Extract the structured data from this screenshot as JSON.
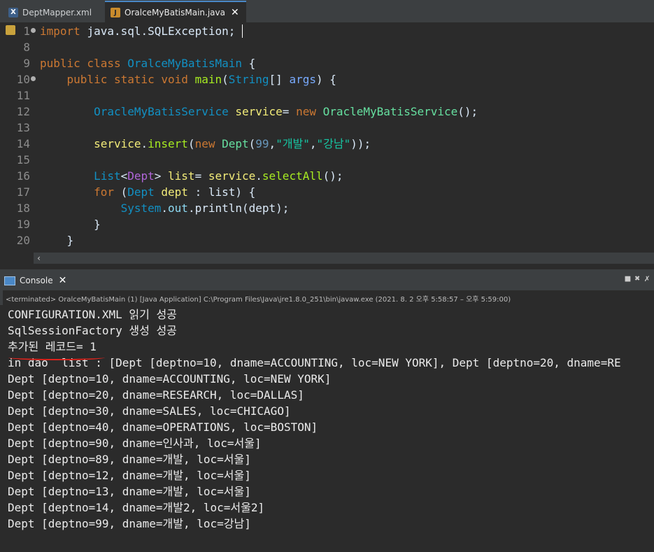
{
  "tabs": [
    {
      "label": "DeptMapper.xml",
      "icon": "xml-file-icon",
      "active": false
    },
    {
      "label": "OralceMyBatisMain.java",
      "icon": "java-file-icon",
      "active": true
    }
  ],
  "editor": {
    "lines": [
      {
        "num": "1",
        "tokens": [
          [
            "kw",
            "import "
          ],
          [
            "plain",
            "java.sql.SQLException;"
          ]
        ]
      },
      {
        "num": "8",
        "tokens": []
      },
      {
        "num": "9",
        "tokens": [
          [
            "kw",
            "public class "
          ],
          [
            "cls",
            "OralceMyBatisMain"
          ],
          [
            "plain",
            " {"
          ]
        ]
      },
      {
        "num": "10",
        "tokens": [
          [
            "kw",
            "    public static void "
          ],
          [
            "method",
            "main"
          ],
          [
            "plain",
            "("
          ],
          [
            "cls",
            "String"
          ],
          [
            "plain",
            "[] "
          ],
          [
            "param",
            "args"
          ],
          [
            "plain",
            ") {"
          ]
        ]
      },
      {
        "num": "11",
        "tokens": []
      },
      {
        "num": "12",
        "tokens": [
          [
            "plain",
            "        "
          ],
          [
            "cls",
            "OracleMyBatisService"
          ],
          [
            "plain",
            " "
          ],
          [
            "var",
            "service"
          ],
          [
            "plain",
            "= "
          ],
          [
            "kw",
            "new "
          ],
          [
            "cls2",
            "OracleMyBatisService"
          ],
          [
            "plain",
            "();"
          ]
        ]
      },
      {
        "num": "13",
        "tokens": []
      },
      {
        "num": "14",
        "tokens": [
          [
            "plain",
            "        "
          ],
          [
            "var",
            "service"
          ],
          [
            "plain",
            "."
          ],
          [
            "method",
            "insert"
          ],
          [
            "plain",
            "("
          ],
          [
            "kw",
            "new "
          ],
          [
            "cls2",
            "Dept"
          ],
          [
            "plain",
            "("
          ],
          [
            "num",
            "99"
          ],
          [
            "plain",
            ","
          ],
          [
            "str",
            "\"개발\""
          ],
          [
            "plain",
            ","
          ],
          [
            "str",
            "\"강남\""
          ],
          [
            "plain",
            "));"
          ]
        ]
      },
      {
        "num": "15",
        "tokens": []
      },
      {
        "num": "16",
        "tokens": [
          [
            "plain",
            "        "
          ],
          [
            "cls",
            "List"
          ],
          [
            "plain",
            "<"
          ],
          [
            "type",
            "Dept"
          ],
          [
            "plain",
            "> "
          ],
          [
            "var",
            "list"
          ],
          [
            "plain",
            "= "
          ],
          [
            "var",
            "service"
          ],
          [
            "plain",
            "."
          ],
          [
            "method",
            "selectAll"
          ],
          [
            "plain",
            "();"
          ]
        ]
      },
      {
        "num": "17",
        "tokens": [
          [
            "kw",
            "        for "
          ],
          [
            "plain",
            "("
          ],
          [
            "cls",
            "Dept"
          ],
          [
            "plain",
            " "
          ],
          [
            "var",
            "dept"
          ],
          [
            "plain",
            " : list) {"
          ]
        ]
      },
      {
        "num": "18",
        "tokens": [
          [
            "plain",
            "            "
          ],
          [
            "cls",
            "System"
          ],
          [
            "plain",
            "."
          ],
          [
            "field",
            "out"
          ],
          [
            "plain",
            ".println(dept);"
          ]
        ]
      },
      {
        "num": "19",
        "tokens": [
          [
            "plain",
            "        }"
          ]
        ]
      },
      {
        "num": "20",
        "tokens": [
          [
            "plain",
            "    }"
          ]
        ]
      }
    ]
  },
  "console": {
    "tab_label": "Console",
    "status": "<terminated> OralceMyBatisMain (1) [Java Application] C:\\Program Files\\Java\\jre1.8.0_251\\bin\\javaw.exe  (2021. 8. 2 오후 5:58:57 – 오후 5:59:00)",
    "output": [
      "CONFIGURATION.XML 읽기 성공",
      "SqlSessionFactory 생성 성공",
      "추가된 레코드= 1",
      "in dao  list : [Dept [deptno=10, dname=ACCOUNTING, loc=NEW YORK], Dept [deptno=20, dname=RE",
      "Dept [deptno=10, dname=ACCOUNTING, loc=NEW YORK]",
      "Dept [deptno=20, dname=RESEARCH, loc=DALLAS]",
      "Dept [deptno=30, dname=SALES, loc=CHICAGO]",
      "Dept [deptno=40, dname=OPERATIONS, loc=BOSTON]",
      "Dept [deptno=90, dname=인사과, loc=서울]",
      "Dept [deptno=89, dname=개발, loc=서울]",
      "Dept [deptno=12, dname=개발, loc=서울]",
      "Dept [deptno=13, dname=개발, loc=서울]",
      "Dept [deptno=14, dname=개발2, loc=서울2]",
      "Dept [deptno=99, dname=개발, loc=강남]"
    ]
  },
  "colors": {
    "keyword": "#cc7832",
    "class": "#1290c3",
    "string": "#17c6a3",
    "annotation_underline": "#e0231c"
  }
}
